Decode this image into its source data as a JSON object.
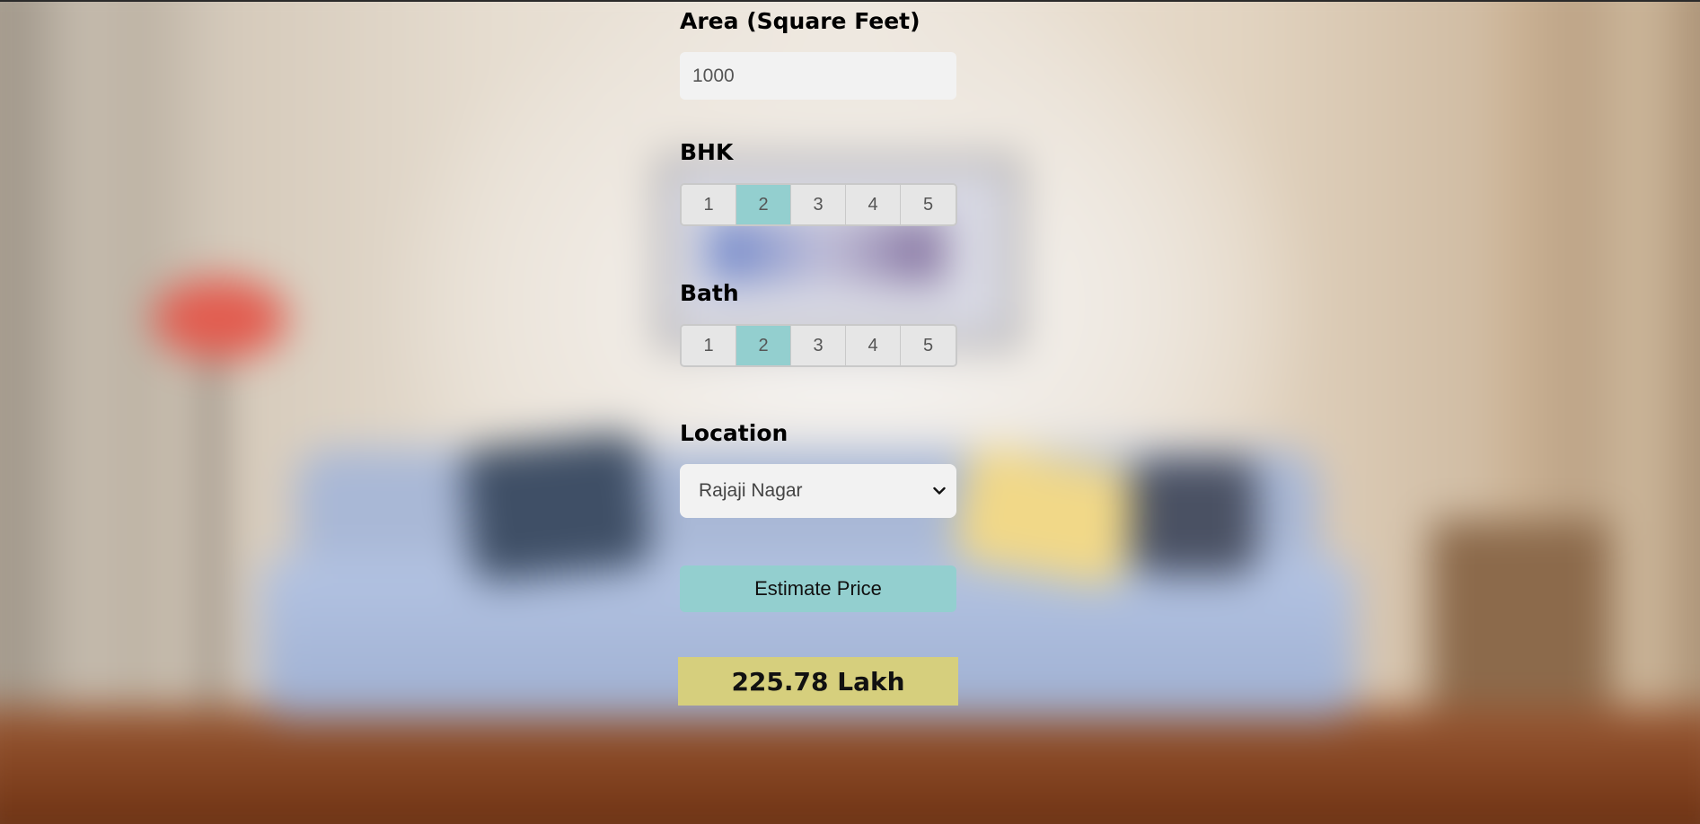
{
  "form": {
    "area": {
      "label": "Area (Square Feet)",
      "value": "1000"
    },
    "bhk": {
      "label": "BHK",
      "options": [
        "1",
        "2",
        "3",
        "4",
        "5"
      ],
      "selected": "2"
    },
    "bath": {
      "label": "Bath",
      "options": [
        "1",
        "2",
        "3",
        "4",
        "5"
      ],
      "selected": "2"
    },
    "location": {
      "label": "Location",
      "selected": "Rajaji Nagar"
    },
    "estimate_button": "Estimate Price",
    "result": "225.78 Lakh"
  },
  "colors": {
    "accent": "#93cfcf",
    "result_bg": "#d6cf7d",
    "input_bg": "#f2f2f2"
  },
  "icons": {
    "location_dropdown": "chevron-down-icon"
  }
}
